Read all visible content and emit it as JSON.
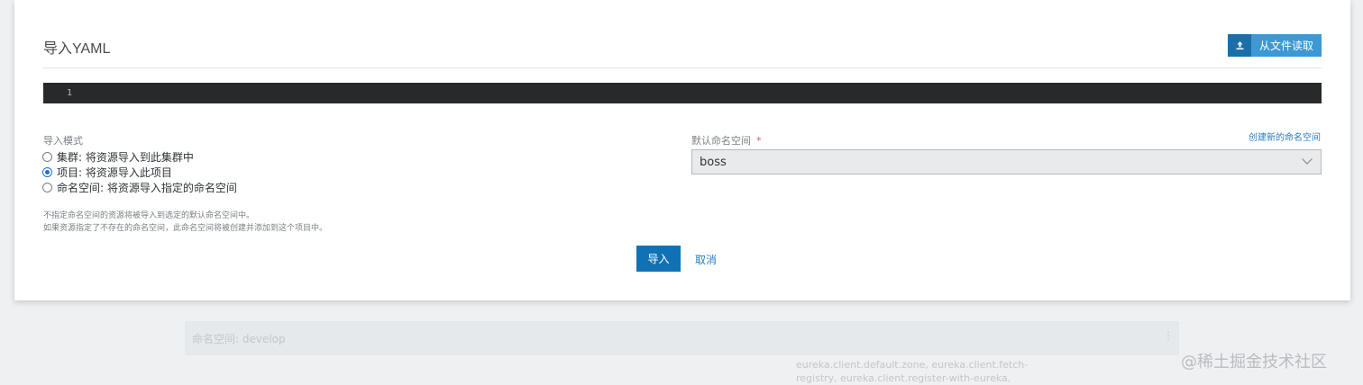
{
  "background": {
    "row_text": "命名空间: develop",
    "row_menu_icon": "kebab-icon",
    "description": "eureka.client.default.zone, eureka.client.fetch-registry, eureka.client.register-with-eureka,",
    "watermark": "@稀土掘金技术社区"
  },
  "modal": {
    "title": "导入YAML",
    "read_file_button": {
      "label": "从文件读取",
      "icon": "upload-icon"
    },
    "editor": {
      "line_number": "1"
    },
    "import_mode": {
      "label": "导入模式",
      "options": [
        {
          "label": "集群: 将资源导入到此集群中",
          "checked": false
        },
        {
          "label": "项目: 将资源导入此项目",
          "checked": true
        },
        {
          "label": "命名空间: 将资源导入指定的命名空间",
          "checked": false
        }
      ]
    },
    "help": {
      "line1": "不指定命名空间的资源将被导入到选定的默认命名空间中。",
      "line2": "如果资源指定了不存在的命名空间，此命名空间将被创建并添加到这个项目中。"
    },
    "namespace": {
      "label": "默认命名空间",
      "required_marker": "*",
      "create_link": "创建新的命名空间",
      "selected": "boss"
    },
    "actions": {
      "import_label": "导入",
      "cancel_label": "取消"
    }
  },
  "colors": {
    "primary": "#1172b3",
    "link": "#2b7cc3",
    "editor_bg": "#27292b",
    "accent_button": "#3d98d3"
  }
}
